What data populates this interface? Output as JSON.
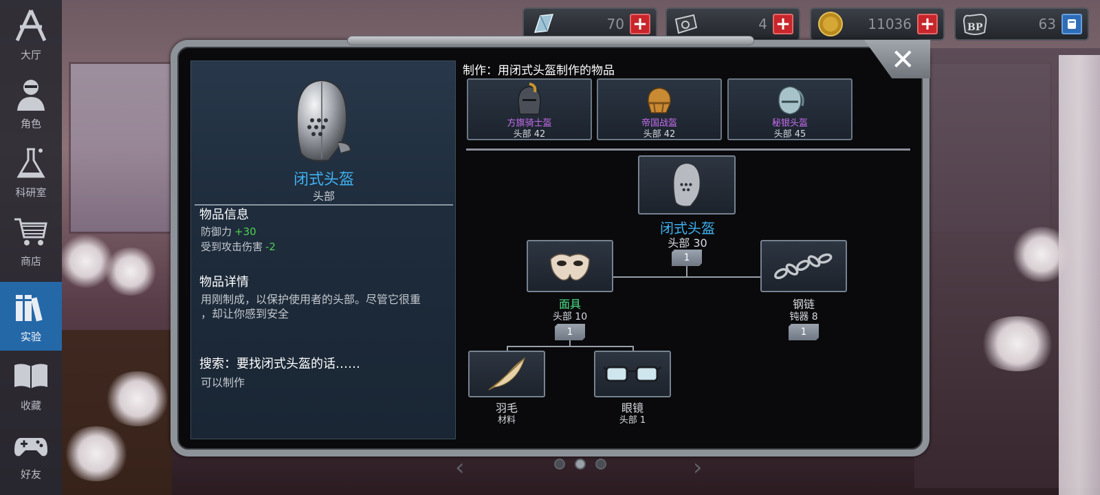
{
  "sidebar": {
    "items": [
      {
        "label": "大厅",
        "icon": "star-a-icon"
      },
      {
        "label": "角色",
        "icon": "character-icon"
      },
      {
        "label": "科研室",
        "icon": "flask-icon"
      },
      {
        "label": "商店",
        "icon": "cart-icon"
      },
      {
        "label": "实验",
        "icon": "books-icon",
        "active": true
      },
      {
        "label": "收藏",
        "icon": "open-book-icon"
      },
      {
        "label": "好友",
        "icon": "gamepad-icon"
      }
    ]
  },
  "currency": [
    {
      "name": "crystal",
      "icon": "crystal-icon",
      "value": "70"
    },
    {
      "name": "ticket",
      "icon": "device-icon",
      "value": "4"
    },
    {
      "name": "coin",
      "icon": "coin-icon",
      "value": "11036"
    },
    {
      "name": "bp",
      "icon": "bp-paw-icon",
      "value": "63"
    }
  ],
  "item": {
    "name": "闭式头盔",
    "slot": "头部",
    "info_heading": "物品信息",
    "stats": [
      {
        "label": "防御力",
        "value": "+30"
      },
      {
        "label": "受到攻击伤害",
        "value": "-2"
      }
    ],
    "detail_heading": "物品详情",
    "detail_text": "用刚制成，以保护使用者的头部。尽管它很重\n，却让你感到安全",
    "search_heading": "搜索：要找闭式头盔的话……",
    "search_text": "可以制作"
  },
  "crafting": {
    "title": "制作：用闭式头盔制作的物品",
    "products": [
      {
        "name": "方旗骑士盔",
        "stat": "头部 42"
      },
      {
        "name": "帝国战盔",
        "stat": "头部 42"
      },
      {
        "name": "秘银头盔",
        "stat": "头部 45"
      }
    ]
  },
  "tree": {
    "root": {
      "name": "闭式头盔",
      "stat": "头部 30",
      "qty": "1"
    },
    "mask": {
      "name": "面具",
      "stat": "头部 10",
      "qty": "1"
    },
    "chain": {
      "name": "钢链",
      "stat": "钝器 8",
      "qty": "1"
    },
    "feather": {
      "name": "羽毛",
      "stat": "材料"
    },
    "glasses": {
      "name": "眼镜",
      "stat": "头部 1"
    }
  },
  "colors": {
    "accent_blue": "#3fb2f2",
    "rare_purple": "#c66ef0",
    "positive_green": "#4ed14e",
    "sidebar_active": "#2468a8"
  }
}
